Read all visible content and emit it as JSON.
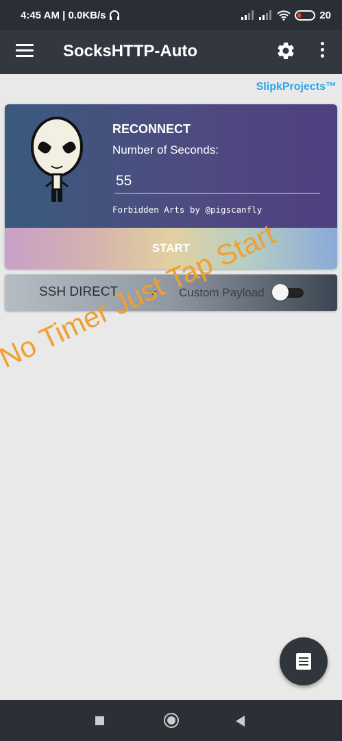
{
  "status_bar": {
    "time_speed": "4:45 AM | 0.0KB/s",
    "battery": "20"
  },
  "app_bar": {
    "title": "SocksHTTP-Auto",
    "icons": [
      "menu-icon",
      "settings-icon",
      "more-vert-icon"
    ]
  },
  "brand": "SlipkProjects™",
  "reconnect_card": {
    "title": "RECONNECT",
    "label": "Number of Seconds:",
    "seconds_value": "55",
    "credit": "Forbidden Arts by @pigscanfly",
    "start_label": "START"
  },
  "mode_bar": {
    "selected_mode": "SSH DIRECT",
    "payload_label": "Custom Payload",
    "payload_toggle_on": false
  },
  "overlay_text": "No Timer Just Tap Start",
  "fab": {
    "icon": "log-icon"
  },
  "nav_bar": {
    "icons": [
      "recents-icon",
      "home-icon",
      "back-icon"
    ]
  },
  "colors": {
    "brand": "#2aa7e8",
    "overlay": "#f0a030",
    "app_bar": "#33373f"
  }
}
